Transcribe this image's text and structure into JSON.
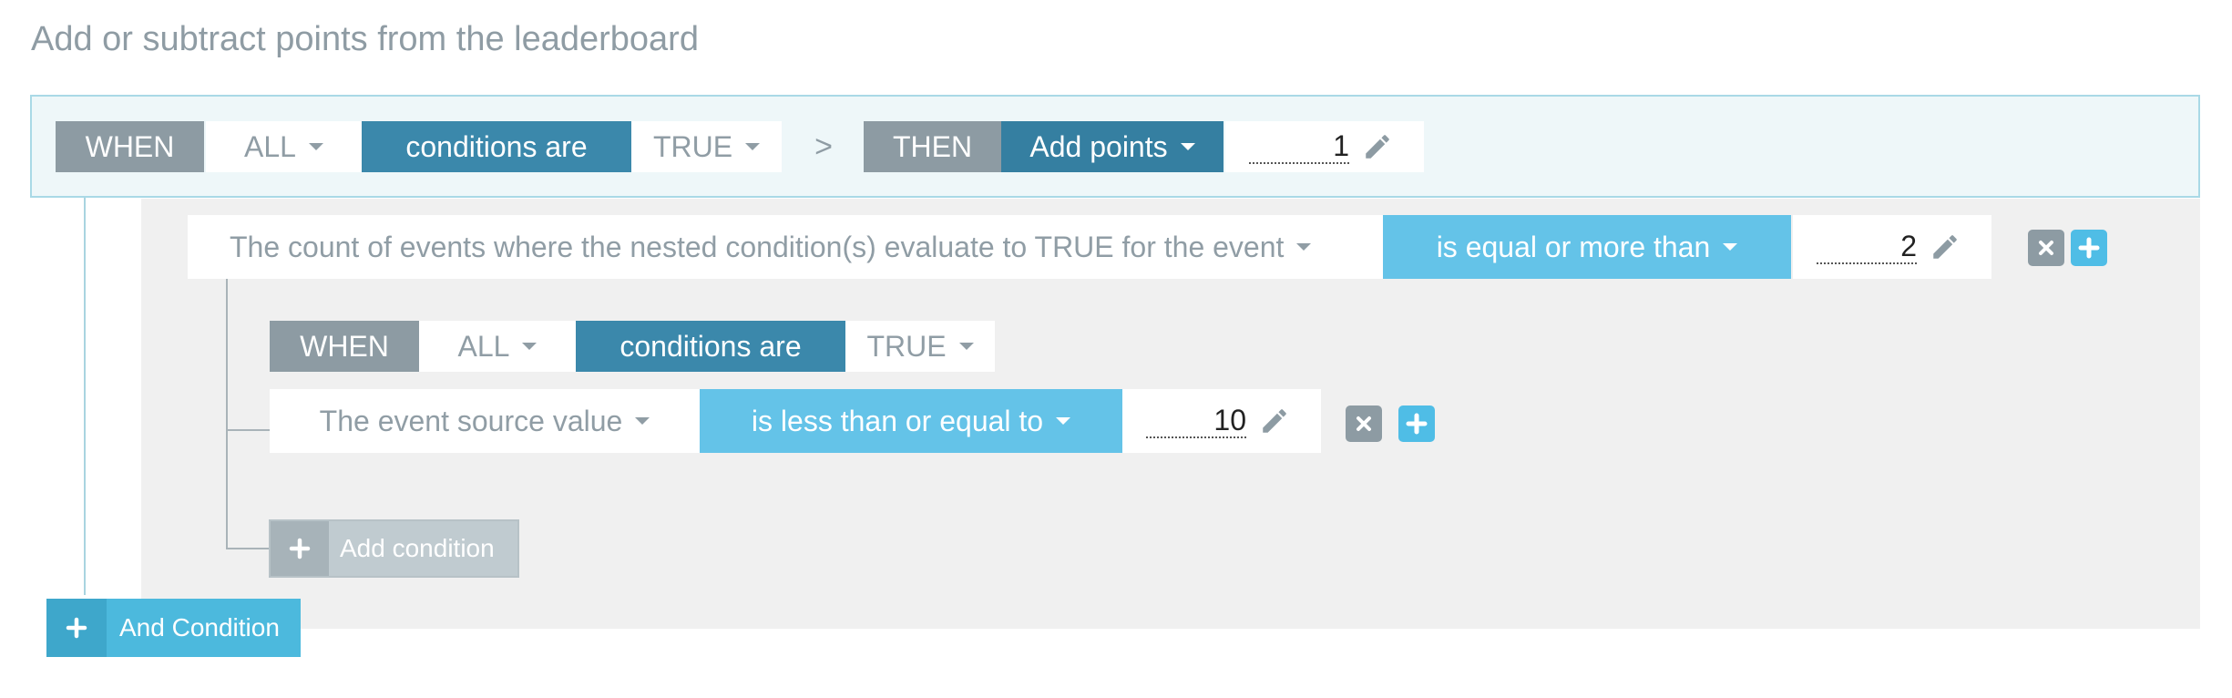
{
  "title": "Add or subtract points from the leaderboard",
  "rule": {
    "when_label": "WHEN",
    "quantifier": "ALL",
    "conditions_label": "conditions are",
    "truth": "TRUE",
    "arrow": ">",
    "then_label": "THEN",
    "action": "Add points",
    "value": "1"
  },
  "condition": {
    "field": "The count of events where the nested condition(s) evaluate to TRUE for the event",
    "operator": "is equal or more than",
    "value": "2"
  },
  "nested": {
    "when_label": "WHEN",
    "quantifier": "ALL",
    "conditions_label": "conditions are",
    "truth": "TRUE",
    "condition": {
      "field": "The event source value",
      "operator": "is less than or equal to",
      "value": "10"
    },
    "add_condition_label": "Add condition"
  },
  "and_condition_label": "And Condition",
  "colors": {
    "accent_teal": "#3b88ab",
    "accent_sky": "#64c3e8",
    "neutral_gray": "#8d9ba3"
  }
}
